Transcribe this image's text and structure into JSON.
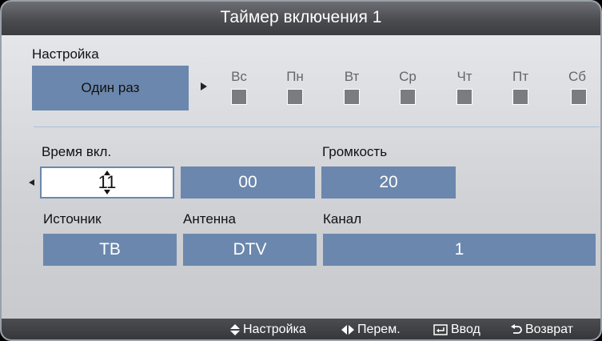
{
  "dialog": {
    "title": "Таймер включения 1"
  },
  "setup": {
    "label": "Настройка",
    "repeat_value": "Один раз",
    "days": [
      {
        "name": "Вс",
        "checked": false
      },
      {
        "name": "Пн",
        "checked": false
      },
      {
        "name": "Вт",
        "checked": false
      },
      {
        "name": "Ср",
        "checked": false
      },
      {
        "name": "Чт",
        "checked": false
      },
      {
        "name": "Пт",
        "checked": false
      },
      {
        "name": "Сб",
        "checked": false
      }
    ]
  },
  "time": {
    "label": "Время вкл.",
    "hour": "11",
    "minute": "00"
  },
  "volume": {
    "label": "Громкость",
    "value": "20"
  },
  "source": {
    "label": "Источник",
    "value": "ТВ"
  },
  "antenna": {
    "label": "Антенна",
    "value": "DTV"
  },
  "channel": {
    "label": "Канал",
    "value": "1"
  },
  "footer": {
    "adjust": "Настройка",
    "move": "Перем.",
    "enter": "Ввод",
    "return": "Возврат"
  },
  "colors": {
    "field": "#6b87ad",
    "titlebar": "#4a4c50",
    "background": "#d4d6da"
  }
}
